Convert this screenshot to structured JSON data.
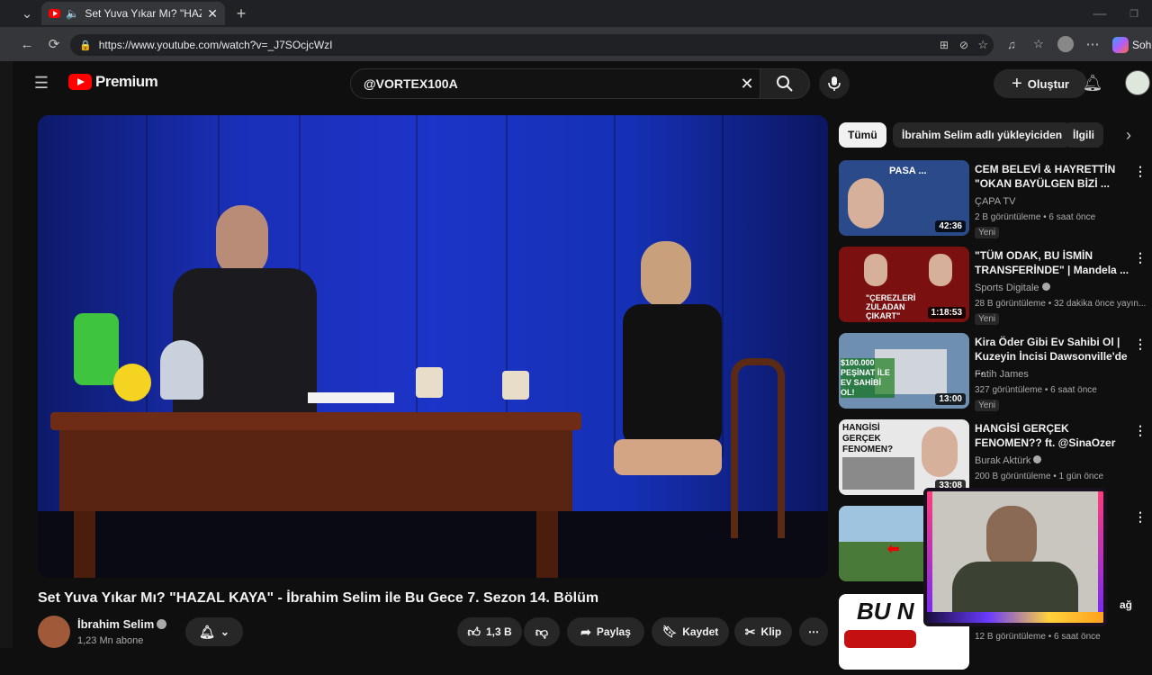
{
  "browser": {
    "tab_title": "Set Yuva Yıkar Mı? \"HAZAL KA",
    "url": "https://www.youtube.com/watch?v=_J7SOcjcWzI",
    "copilot_label": "Soh"
  },
  "youtube": {
    "logo_text": "Premium",
    "search_value": "@VORTEX100A",
    "create_label": "Oluştur",
    "brand_color": "#ff0000"
  },
  "video": {
    "title": "Set Yuva Yıkar Mı? \"HAZAL KAYA\" - İbrahim Selim ile Bu Gece 7. Sezon 14. Bölüm",
    "channel_name": "İbrahim Selim",
    "subscribers": "1,23 Mn abone",
    "likes": "1,3 B",
    "share_label": "Paylaş",
    "save_label": "Kaydet",
    "clip_label": "Klip"
  },
  "filter_chips": [
    "Tümü",
    "İbrahim Selim adlı yükleyiciden",
    "İlgili"
  ],
  "recommendations": [
    {
      "title": "CEM BELEVİ & HAYRETTİN \"OKAN BAYÜLGEN BİZİ ...",
      "channel": "ÇAPA TV",
      "meta": "2 B görüntüleme • 6 saat önce",
      "badge": "Yeni",
      "duration": "42:36",
      "thumb_text": "PASA ...",
      "thumb_color": "#2b4a8a"
    },
    {
      "title": "\"TÜM ODAK, BU İSMİN TRANSFERİNDE\" | Mandela ...",
      "channel": "Sports Digitale",
      "meta": "28 B görüntüleme • 32 dakika önce yayın...",
      "badge": "Yeni",
      "duration": "1:18:53",
      "thumb_text": "\"ÇEREZLERİ ZULADAN ÇIKART\"",
      "thumb_color": "#7a1010"
    },
    {
      "title": "Kira Öder Gibi Ev Sahibi Ol | Kuzeyin İncisi Dawsonville'de ...",
      "channel": "Fatih James",
      "meta": "327 görüntüleme • 6 saat önce",
      "badge": "Yeni",
      "duration": "13:00",
      "thumb_text": "$100.000 PEŞİNAT İLE EV SAHİBİ OL!",
      "thumb_color": "#6f8fb0"
    },
    {
      "title": "HANGİSİ GERÇEK FENOMEN?? ft. @SinaOzer",
      "channel": "Burak Aktürk",
      "meta": "200 B görüntüleme • 1 gün önce",
      "badge": "",
      "duration": "33:08",
      "thumb_text": "HANGİSİ GERÇEK FENOMEN?",
      "thumb_color": "#e8e8e8"
    },
    {
      "title": "",
      "channel": "",
      "meta": "",
      "badge": "",
      "duration": "",
      "thumb_text": "",
      "thumb_color": "#4a7a3a"
    },
    {
      "title": "ağ",
      "channel": "",
      "meta": "12 B görüntüleme • 6 saat önce",
      "badge": "",
      "duration": "",
      "thumb_text": "BU N",
      "thumb_color": "#ffffff"
    }
  ]
}
